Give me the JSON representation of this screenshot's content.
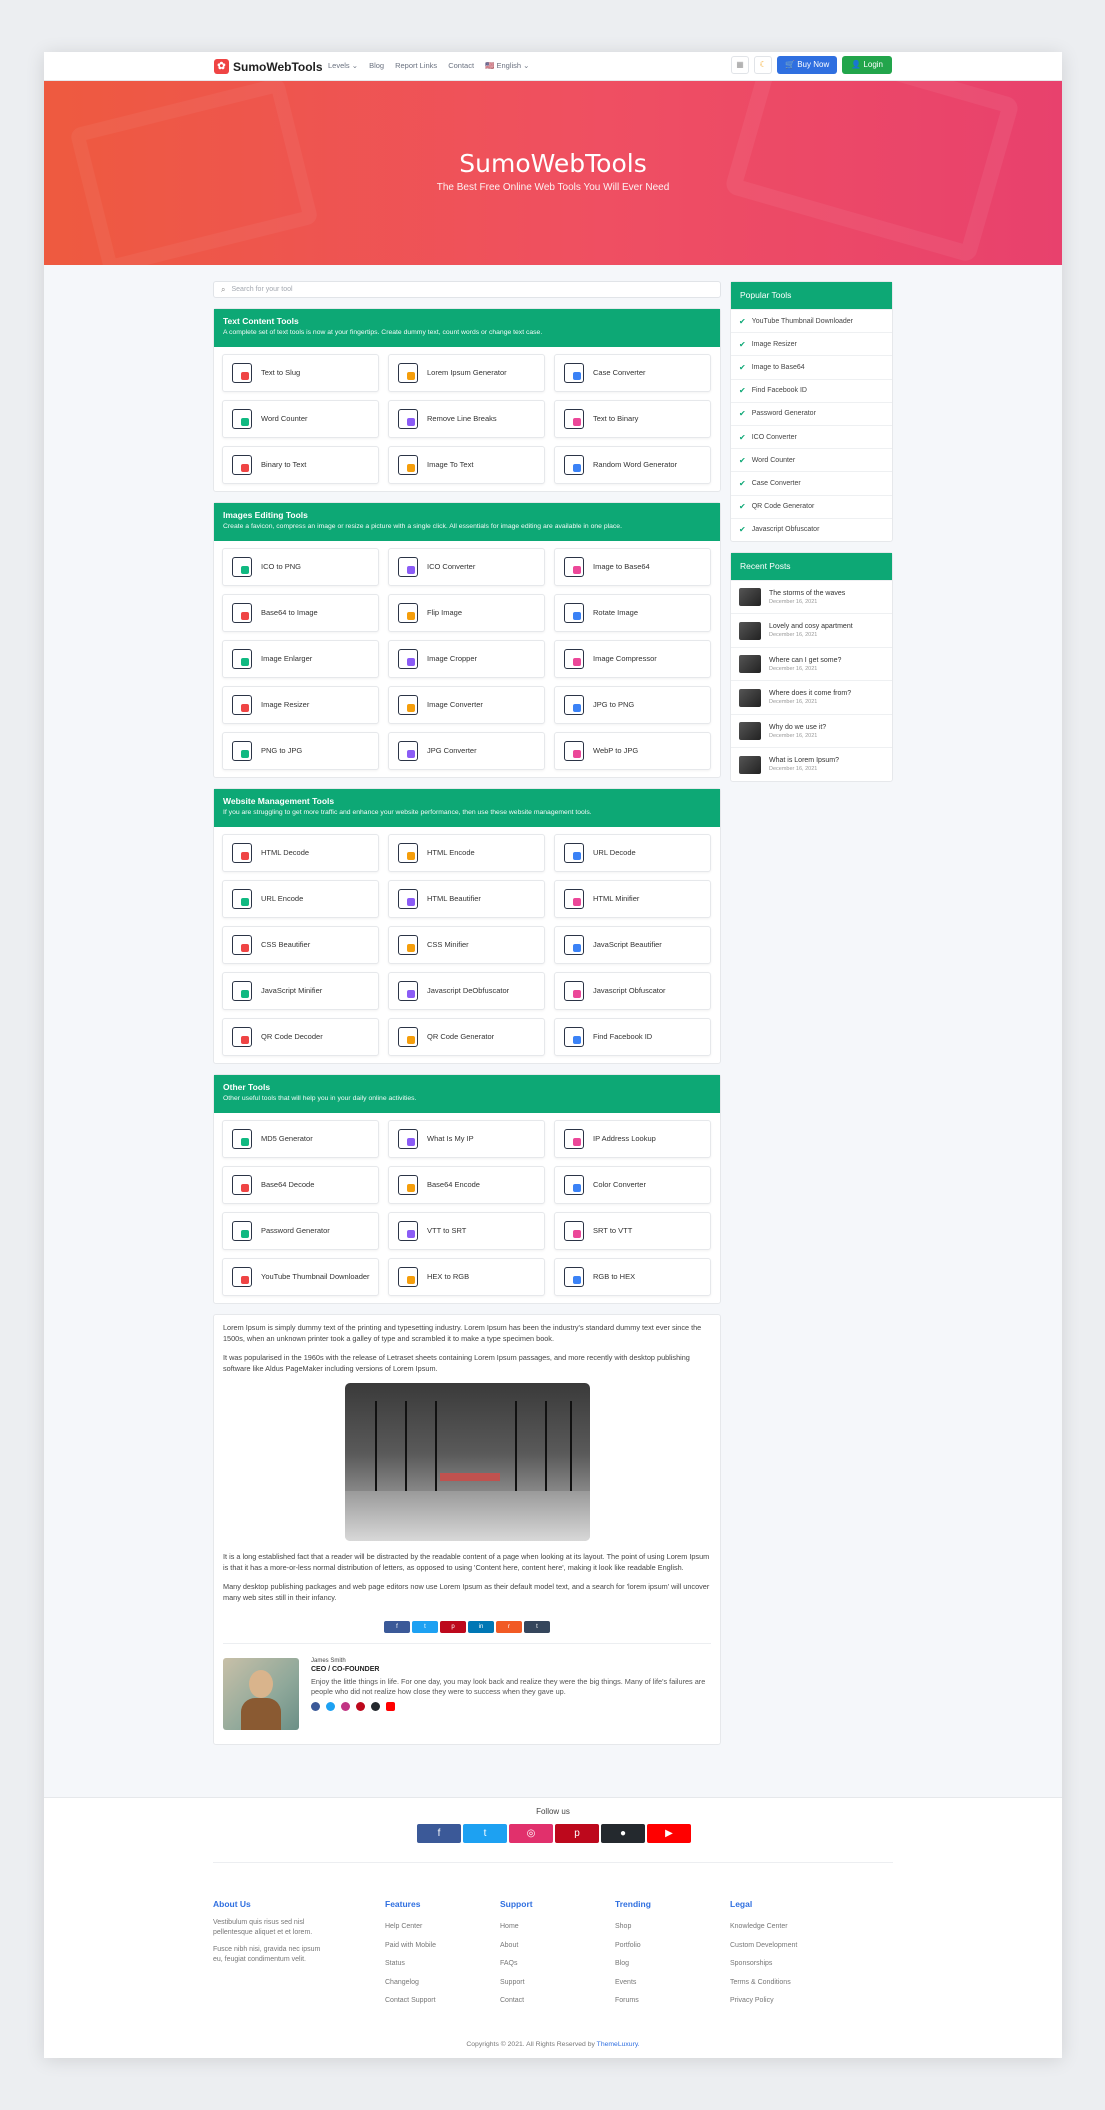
{
  "nav": {
    "logo": "SumoWebTools",
    "menu": [
      "Levels ⌄",
      "Blog",
      "Report Links",
      "Contact",
      "🇺🇸 English ⌄"
    ],
    "buy_now": "Buy Now",
    "login": "Login"
  },
  "hero": {
    "title": "SumoWebTools",
    "subtitle": "The Best Free Online Web Tools You Will Ever Need"
  },
  "search": {
    "placeholder": "Search for your tool"
  },
  "categories": [
    {
      "title": "Text Content Tools",
      "desc": "A complete set of text tools is now at your fingertips. Create dummy text, count words or change text case.",
      "tools": [
        "Text to Slug",
        "Lorem Ipsum Generator",
        "Case Converter",
        "Word Counter",
        "Remove Line Breaks",
        "Text to Binary",
        "Binary to Text",
        "Image To Text",
        "Random Word Generator"
      ]
    },
    {
      "title": "Images Editing Tools",
      "desc": "Create a favicon, compress an image or resize a picture with a single click. All essentials for image editing are available in one place.",
      "tools": [
        "ICO to PNG",
        "ICO Converter",
        "Image to Base64",
        "Base64 to Image",
        "Flip Image",
        "Rotate Image",
        "Image Enlarger",
        "Image Cropper",
        "Image Compressor",
        "Image Resizer",
        "Image Converter",
        "JPG to PNG",
        "PNG to JPG",
        "JPG Converter",
        "WebP to JPG"
      ]
    },
    {
      "title": "Website Management Tools",
      "desc": "If you are struggling to get more traffic and enhance your website performance, then use these website management tools.",
      "tools": [
        "HTML Decode",
        "HTML Encode",
        "URL Decode",
        "URL Encode",
        "HTML Beautifier",
        "HTML Minifier",
        "CSS Beautifier",
        "CSS Minifier",
        "JavaScript Beautifier",
        "JavaScript Minifier",
        "Javascript DeObfuscator",
        "Javascript Obfuscator",
        "QR Code Decoder",
        "QR Code Generator",
        "Find Facebook ID"
      ]
    },
    {
      "title": "Other Tools",
      "desc": "Other useful tools that will help you in your daily online activities.",
      "tools": [
        "MD5 Generator",
        "What Is My IP",
        "IP Address Lookup",
        "Base64 Decode",
        "Base64 Encode",
        "Color Converter",
        "Password Generator",
        "VTT to SRT",
        "SRT to VTT",
        "YouTube Thumbnail Downloader",
        "HEX to RGB",
        "RGB to HEX"
      ]
    }
  ],
  "article": {
    "p1": "Lorem Ipsum is simply dummy text of the printing and typesetting industry. Lorem Ipsum has been the industry's standard dummy text ever since the 1500s, when an unknown printer took a galley of type and scrambled it to make a type specimen book.",
    "p2": "It was popularised in the 1960s with the release of Letraset sheets containing Lorem Ipsum passages, and more recently with desktop publishing software like Aldus PageMaker including versions of Lorem Ipsum.",
    "p3": "It is a long established fact that a reader will be distracted by the readable content of a page when looking at its layout. The point of using Lorem Ipsum is that it has a more-or-less normal distribution of letters, as opposed to using 'Content here, content here', making it look like readable English.",
    "p4": "Many desktop publishing packages and web page editors now use Lorem Ipsum as their default model text, and a search for 'lorem ipsum' will uncover many web sites still in their infancy."
  },
  "share_colors": [
    "#3b5998",
    "#1da1f2",
    "#bd081c",
    "#0077b5",
    "#f15a24",
    "#35465c"
  ],
  "share_icons": [
    "f",
    "t",
    "p",
    "in",
    "r",
    "t"
  ],
  "author": {
    "name": "James Smith",
    "role": "CEO / CO-FOUNDER",
    "bio": "Enjoy the little things in life. For one day, you may look back and realize they were the big things. Many of life's failures are people who did not realize how close they were to success when they gave up."
  },
  "popular": {
    "title": "Popular Tools",
    "items": [
      "YouTube Thumbnail Downloader",
      "Image Resizer",
      "Image to Base64",
      "Find Facebook ID",
      "Password Generator",
      "ICO Converter",
      "Word Counter",
      "Case Converter",
      "QR Code Generator",
      "Javascript Obfuscator"
    ]
  },
  "recent": {
    "title": "Recent Posts",
    "posts": [
      {
        "title": "The storms of the waves",
        "date": "December 16, 2021"
      },
      {
        "title": "Lovely and cosy apartment",
        "date": "December 16, 2021"
      },
      {
        "title": "Where can I get some?",
        "date": "December 16, 2021"
      },
      {
        "title": "Where does it come from?",
        "date": "December 16, 2021"
      },
      {
        "title": "Why do we use it?",
        "date": "December 16, 2021"
      },
      {
        "title": "What is Lorem Ipsum?",
        "date": "December 16, 2021"
      }
    ]
  },
  "footer": {
    "follow": "Follow us",
    "social_colors": [
      "#3b5998",
      "#1da1f2",
      "#e1306c",
      "#bd081c",
      "#24292e",
      "#ff0000"
    ],
    "about_title": "About Us",
    "about_p1": "Vestibulum quis risus sed nisl pellentesque aliquet et et lorem.",
    "about_p2": "Fusce nibh nisi, gravida nec ipsum eu, feugiat condimentum velit.",
    "columns": [
      {
        "title": "Features",
        "links": [
          "Help Center",
          "Paid with Mobile",
          "Status",
          "Changelog",
          "Contact Support"
        ]
      },
      {
        "title": "Support",
        "links": [
          "Home",
          "About",
          "FAQs",
          "Support",
          "Contact"
        ]
      },
      {
        "title": "Trending",
        "links": [
          "Shop",
          "Portfolio",
          "Blog",
          "Events",
          "Forums"
        ]
      },
      {
        "title": "Legal",
        "links": [
          "Knowledge Center",
          "Custom Development",
          "Sponsorships",
          "Terms & Conditions",
          "Privacy Policy"
        ]
      }
    ],
    "copyright": "Copyrights © 2021. All Rights Reserved by",
    "copyright_link": "ThemeLuxury."
  }
}
